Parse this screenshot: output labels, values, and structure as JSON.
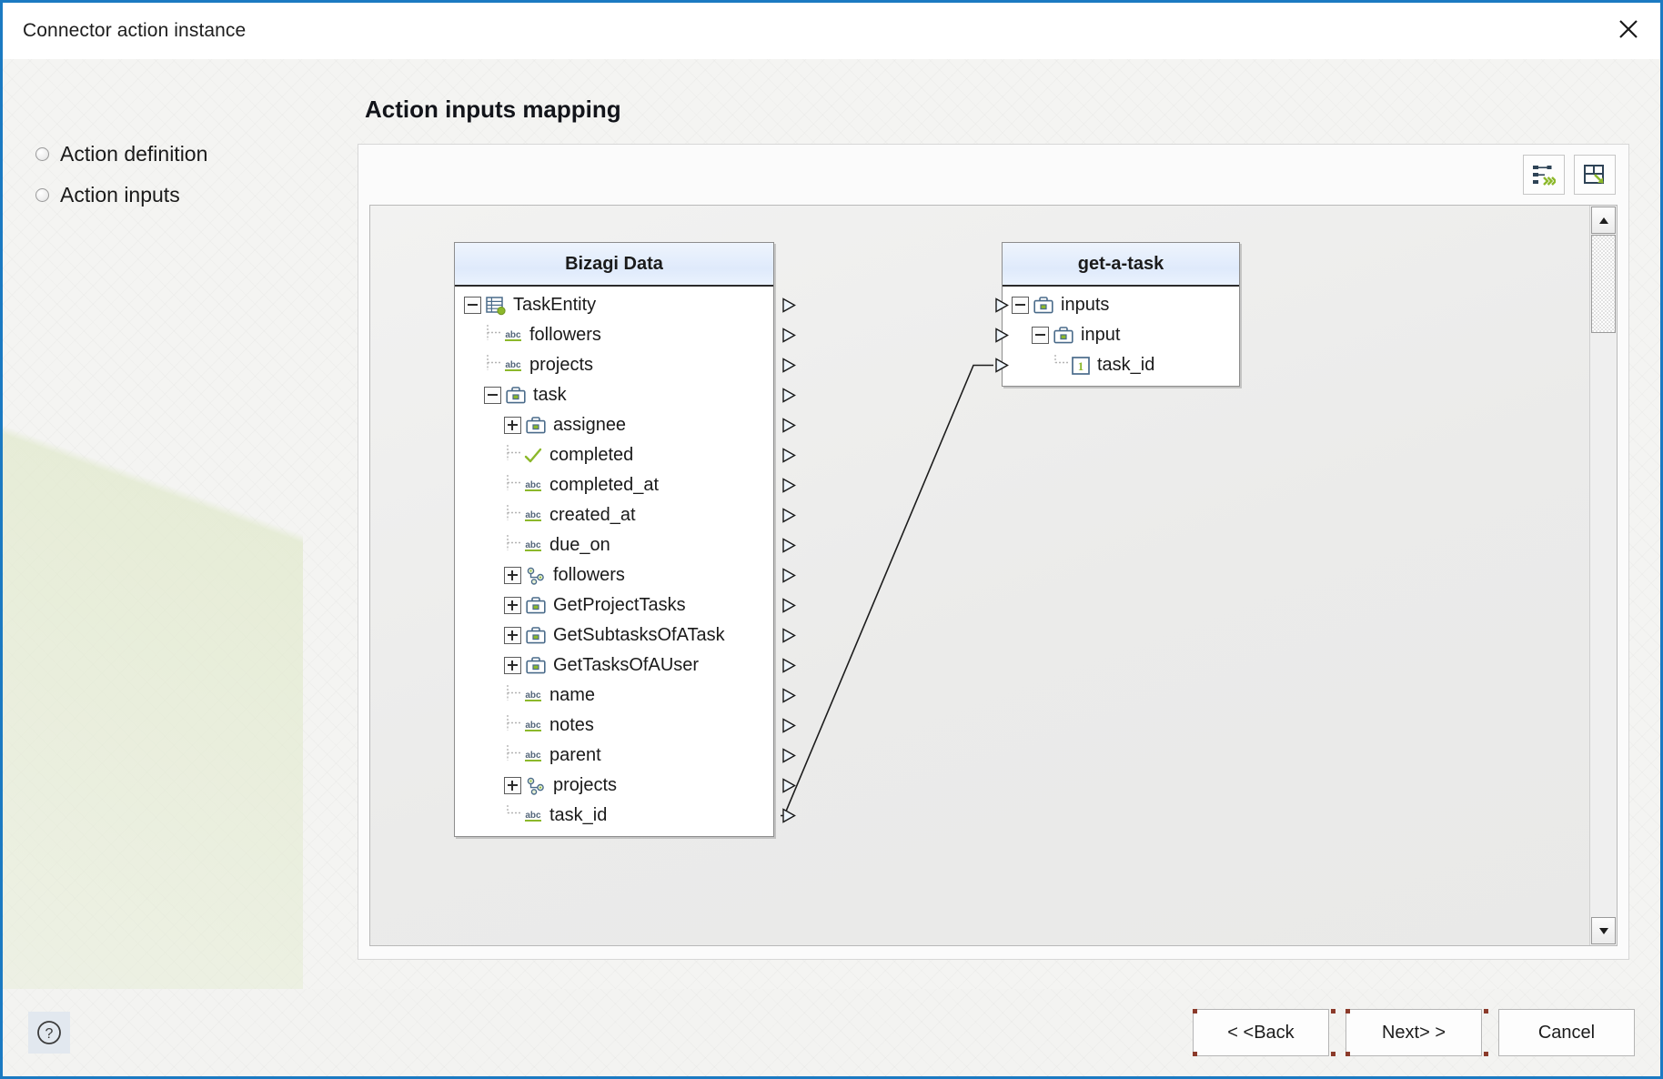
{
  "window": {
    "title": "Connector action instance",
    "close_icon": "close-icon"
  },
  "sidebar": {
    "items": [
      {
        "label": "Action definition",
        "icon": "bullet-icon"
      },
      {
        "label": "Action inputs",
        "icon": "bullet-icon"
      }
    ]
  },
  "main": {
    "page_title": "Action inputs mapping",
    "toolbar": {
      "buttons": [
        {
          "name": "auto-map-button",
          "icon": "auto-map-icon"
        },
        {
          "name": "fit-layout-button",
          "icon": "fit-layout-icon"
        }
      ]
    }
  },
  "mapping": {
    "source_node": {
      "title": "Bizagi Data",
      "rows": [
        {
          "label": "TaskEntity",
          "depth": 0,
          "expander": "minus",
          "icon": "entity-icon",
          "port": true
        },
        {
          "label": "followers",
          "depth": 1,
          "expander": "none",
          "icon": "abc-icon",
          "port": true
        },
        {
          "label": "projects",
          "depth": 1,
          "expander": "none",
          "icon": "abc-icon",
          "port": true
        },
        {
          "label": "task",
          "depth": 1,
          "expander": "minus",
          "icon": "briefcase-icon",
          "port": true
        },
        {
          "label": "assignee",
          "depth": 2,
          "expander": "plus",
          "icon": "briefcase-icon",
          "port": true
        },
        {
          "label": "completed",
          "depth": 2,
          "expander": "none",
          "icon": "check-icon",
          "port": true
        },
        {
          "label": "completed_at",
          "depth": 2,
          "expander": "none",
          "icon": "abc-icon",
          "port": true
        },
        {
          "label": "created_at",
          "depth": 2,
          "expander": "none",
          "icon": "abc-icon",
          "port": true
        },
        {
          "label": "due_on",
          "depth": 2,
          "expander": "none",
          "icon": "abc-icon",
          "port": true
        },
        {
          "label": "followers",
          "depth": 2,
          "expander": "plus",
          "icon": "collection-icon",
          "port": true
        },
        {
          "label": "GetProjectTasks",
          "depth": 2,
          "expander": "plus",
          "icon": "briefcase-icon",
          "port": true
        },
        {
          "label": "GetSubtasksOfATask",
          "depth": 2,
          "expander": "plus",
          "icon": "briefcase-icon",
          "port": true
        },
        {
          "label": "GetTasksOfAUser",
          "depth": 2,
          "expander": "plus",
          "icon": "briefcase-icon",
          "port": true
        },
        {
          "label": "name",
          "depth": 2,
          "expander": "none",
          "icon": "abc-icon",
          "port": true
        },
        {
          "label": "notes",
          "depth": 2,
          "expander": "none",
          "icon": "abc-icon",
          "port": true
        },
        {
          "label": "parent",
          "depth": 2,
          "expander": "none",
          "icon": "abc-icon",
          "port": true
        },
        {
          "label": "projects",
          "depth": 2,
          "expander": "plus",
          "icon": "collection-icon",
          "port": true
        },
        {
          "label": "task_id",
          "depth": 2,
          "expander": "none",
          "icon": "abc-icon",
          "port": true
        }
      ]
    },
    "target_node": {
      "title": "get-a-task",
      "rows": [
        {
          "label": "inputs",
          "depth": 0,
          "expander": "minus",
          "icon": "briefcase-icon",
          "port": true
        },
        {
          "label": "input",
          "depth": 1,
          "expander": "minus",
          "icon": "briefcase-icon",
          "port": true
        },
        {
          "label": "task_id",
          "depth": 2,
          "expander": "none",
          "icon": "number-icon",
          "port": true
        }
      ]
    },
    "connections": [
      {
        "from": "task_id",
        "to": "task_id"
      }
    ]
  },
  "scrollbar": {
    "up_icon": "caret-up-icon",
    "down_icon": "caret-down-icon"
  },
  "footer": {
    "help_icon": "help-icon",
    "back_label": "< <Back",
    "next_label": "Next> >",
    "cancel_label": "Cancel"
  },
  "colors": {
    "accent": "#1b7ac2",
    "node_header": "#dfeafb",
    "green": "#8cb82b",
    "icon_blue": "#4a6b8a"
  }
}
